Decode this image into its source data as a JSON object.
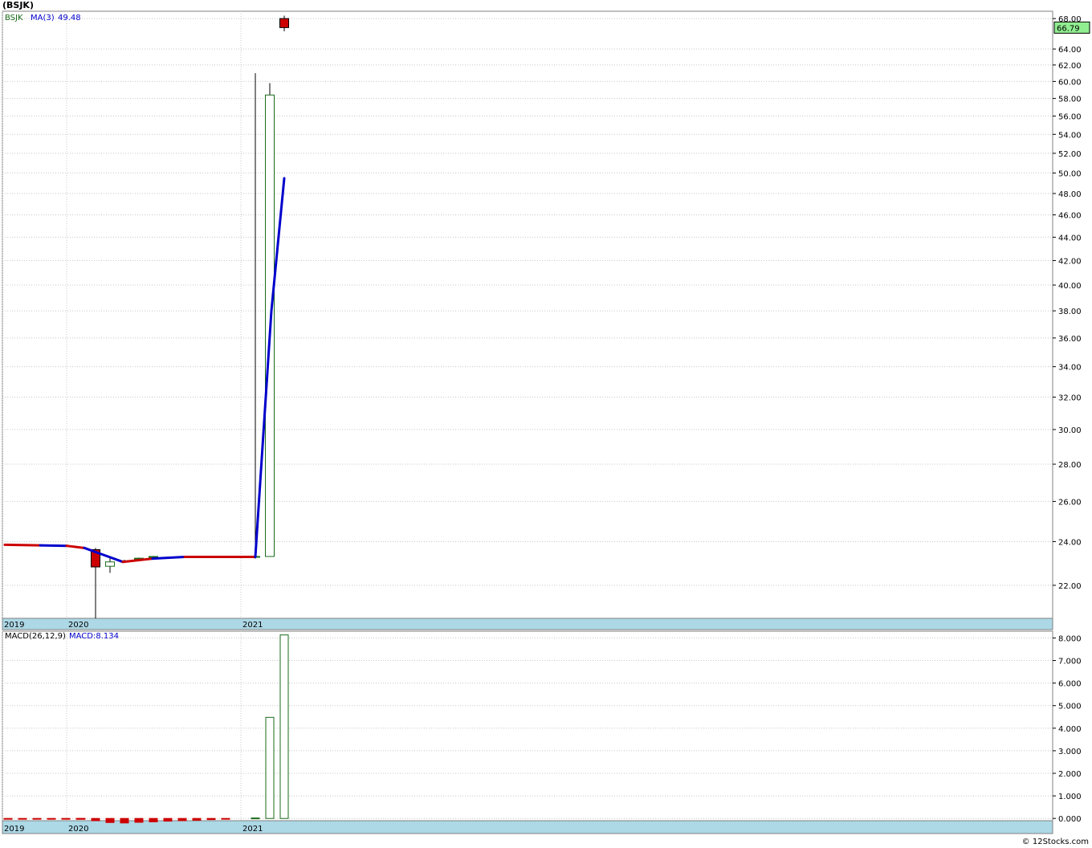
{
  "header": {
    "title": "(BSJK)"
  },
  "footer": {
    "credit": "© 12Stocks.com"
  },
  "colors": {
    "up": "#1a6b1a",
    "down": "#cc0000",
    "ma": "#0000cc",
    "axis_bar": "#add8e6",
    "grid": "#c8c8c8",
    "last_price_bg": "#90ee90"
  },
  "chart_data": [
    {
      "type": "candlestick",
      "legend": {
        "symbol": "BSJK",
        "ma_label": "MA(3)",
        "ma_value": "49.48"
      },
      "last_price": "66.79",
      "ylim": [
        20.6,
        69.0
      ],
      "yscale": "log",
      "y_ticks": [
        "22.00",
        "24.00",
        "26.00",
        "28.00",
        "30.00",
        "32.00",
        "34.00",
        "36.00",
        "38.00",
        "40.00",
        "42.00",
        "44.00",
        "46.00",
        "48.00",
        "50.00",
        "52.00",
        "54.00",
        "56.00",
        "58.00",
        "60.00",
        "62.00",
        "64.00",
        "68.00"
      ],
      "x_labels": [
        "2019",
        "2020",
        "2021"
      ],
      "candles": [
        {
          "o": 23.62,
          "h": 23.7,
          "l": 20.6,
          "c": 22.82
        },
        {
          "o": 22.85,
          "h": 23.25,
          "l": 22.55,
          "c": 23.05
        },
        {
          "o": 23.05,
          "h": 23.15,
          "l": 23.0,
          "c": 23.1
        },
        {
          "o": 23.2,
          "h": 23.25,
          "l": 23.15,
          "c": 23.22
        },
        {
          "o": 23.28,
          "h": 23.32,
          "l": 23.25,
          "c": 23.3
        },
        {
          "o": 23.28,
          "h": 61.0,
          "l": 23.2,
          "c": 23.3
        },
        {
          "o": 23.3,
          "h": 59.8,
          "l": 23.3,
          "c": 58.4
        },
        {
          "o": 68.0,
          "h": 68.4,
          "l": 66.3,
          "c": 66.79
        }
      ],
      "ma": [
        {
          "x": "2019",
          "y": 23.85
        },
        {
          "x": "2019.5",
          "y": 23.82
        },
        {
          "x": "2020",
          "y": 23.8
        },
        {
          "x": "2020.2",
          "y": 23.7
        },
        {
          "x": "2020.4",
          "y": 23.05
        },
        {
          "x": "2020.6",
          "y": 23.2
        },
        {
          "x": "2020.8",
          "y": 23.28
        },
        {
          "x": "2021.1",
          "y": 23.28
        },
        {
          "x": "2021.2",
          "y": 38.0
        },
        {
          "x": "2021.3",
          "y": 49.48
        }
      ]
    },
    {
      "type": "bar",
      "legend": {
        "name": "MACD(26,12,9)",
        "value_label": "MACD:8.134"
      },
      "ylim": [
        -0.1,
        8.3
      ],
      "y_ticks": [
        "0.000",
        "1.000",
        "2.000",
        "3.000",
        "4.000",
        "5.000",
        "6.000",
        "7.000",
        "8.000"
      ],
      "x_labels": [
        "2019",
        "2020",
        "2021"
      ],
      "values": [
        -0.03,
        -0.03,
        -0.03,
        -0.03,
        -0.03,
        -0.03,
        -0.03,
        -0.1,
        -0.18,
        -0.2,
        -0.17,
        -0.15,
        -0.12,
        -0.1,
        -0.08,
        -0.05,
        -0.03,
        0.02,
        4.48,
        8.134
      ]
    }
  ]
}
